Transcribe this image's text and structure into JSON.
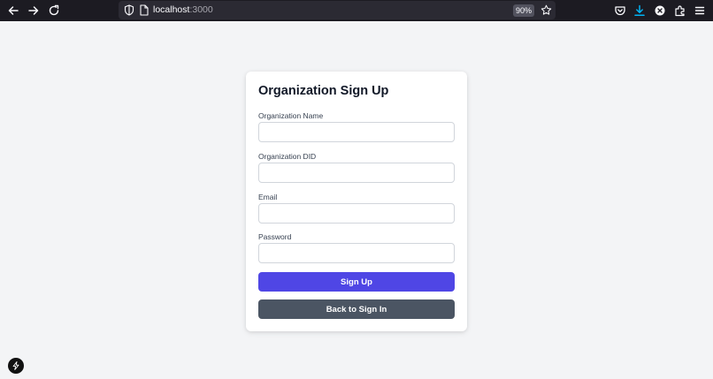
{
  "browser": {
    "url_host": "localhost",
    "url_port": ":3000",
    "zoom": "90%"
  },
  "form": {
    "title": "Organization Sign Up",
    "fields": [
      {
        "label": "Organization Name",
        "value": "",
        "placeholder": ""
      },
      {
        "label": "Organization DID",
        "value": "",
        "placeholder": ""
      },
      {
        "label": "Email",
        "value": "",
        "placeholder": ""
      },
      {
        "label": "Password",
        "value": "",
        "placeholder": ""
      }
    ],
    "signup_label": "Sign Up",
    "back_label": "Back to Sign In"
  },
  "colors": {
    "primary": "#4f46e5",
    "secondary": "#4b5563",
    "background": "#f3f4f6",
    "toolbar": "#1c1b22",
    "download_accent": "#00b3f4"
  },
  "icons": {
    "toolbar": [
      "back-arrow-icon",
      "forward-arrow-icon",
      "reload-icon",
      "shield-icon",
      "page-icon",
      "star-icon",
      "pocket-icon",
      "download-icon",
      "close-icon",
      "extensions-icon",
      "menu-icon"
    ],
    "badge": "lightning-icon"
  }
}
